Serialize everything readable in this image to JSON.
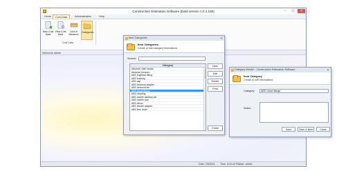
{
  "app": {
    "title": "Construction Estimation Software (build version 1.0.4.180)",
    "window_controls": [
      "–",
      "☐",
      "✕"
    ]
  },
  "menu": {
    "tabs": [
      "Home",
      "Cost Data",
      "Administration",
      "Help"
    ],
    "active_tab": "Cost Data"
  },
  "ribbon": {
    "buttons": [
      {
        "label": "New Cost Data",
        "icon": "new-document-icon"
      },
      {
        "label": "View Cost Data",
        "icon": "view-document-icon"
      },
      {
        "label": "Unit of Measure",
        "icon": "ruler-icon"
      },
      {
        "label": "Categories",
        "icon": "folder-icon"
      }
    ],
    "group_label": "Cost Data"
  },
  "welcome": "Welcome admin",
  "status": {
    "date": "Date: 7/8/2021",
    "time": "Time: 8:16:43 PM",
    "user": "User: admin"
  },
  "categories_dialog": {
    "title": "Item Categories",
    "header_title": "Item Categories",
    "header_subtitle": "Create or edit category informations",
    "search_label": "Search:",
    "search_value": "",
    "column_header": "Category",
    "rows": [
      "Abrasive stain treads",
      "Abrasive terrazzo",
      "ABS bughead fitting",
      "ABS bushing",
      "ABS cap",
      "ABS cleanout adapter",
      "ABS cleanout tee",
      "ABS closet flange",
      "ABS coupling",
      "ABS double sanitary tee",
      "ABS double wye",
      "ABS elbow",
      "ABS female adapter",
      "ABS floor drain"
    ],
    "selected_row": "ABS closet flange",
    "buttons": {
      "new": "New",
      "edit": "Edit",
      "delete": "Delete",
      "print": "Print",
      "close": "Close"
    }
  },
  "details_dialog": {
    "title": "Category Details - Construction Estimation Software",
    "header_title": "Item Category",
    "header_subtitle": "Create or edit informations",
    "category_label": "Category:",
    "category_value": "ABS closet flange",
    "notes_label": "Notes:",
    "notes_value": "",
    "buttons": {
      "save": "Save",
      "save_new": "Save & New",
      "close": "Close"
    }
  }
}
